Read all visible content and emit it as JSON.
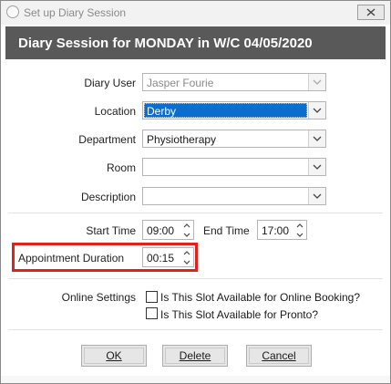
{
  "window": {
    "title": "Set up Diary Session"
  },
  "header": {
    "title": "Diary Session for MONDAY in W/C 04/05/2020"
  },
  "form": {
    "diary_user": {
      "label": "Diary User",
      "value": "Jasper Fourie"
    },
    "location": {
      "label": "Location",
      "value": "Derby"
    },
    "department": {
      "label": "Department",
      "value": "Physiotherapy"
    },
    "room": {
      "label": "Room",
      "value": ""
    },
    "description": {
      "label": "Description",
      "value": ""
    },
    "start_time": {
      "label": "Start Time",
      "value": "09:00"
    },
    "end_time": {
      "label": "End Time",
      "value": "17:00"
    },
    "appointment_duration": {
      "label": "Appointment Duration",
      "value": "00:15"
    },
    "online_settings": {
      "label": "Online Settings",
      "options": [
        {
          "label": "Is This Slot Available for Online Booking?",
          "checked": false
        },
        {
          "label": "Is This Slot Available for Pronto?",
          "checked": false
        }
      ]
    }
  },
  "buttons": {
    "ok": "OK",
    "delete": "Delete",
    "cancel": "Cancel"
  },
  "colors": {
    "header_bg": "#595959",
    "selection": "#0a6ed1",
    "highlight_border": "#e0211f"
  },
  "icons": {
    "close": "close-icon",
    "title": "app-icon",
    "dropdown": "chevron-down-icon"
  }
}
